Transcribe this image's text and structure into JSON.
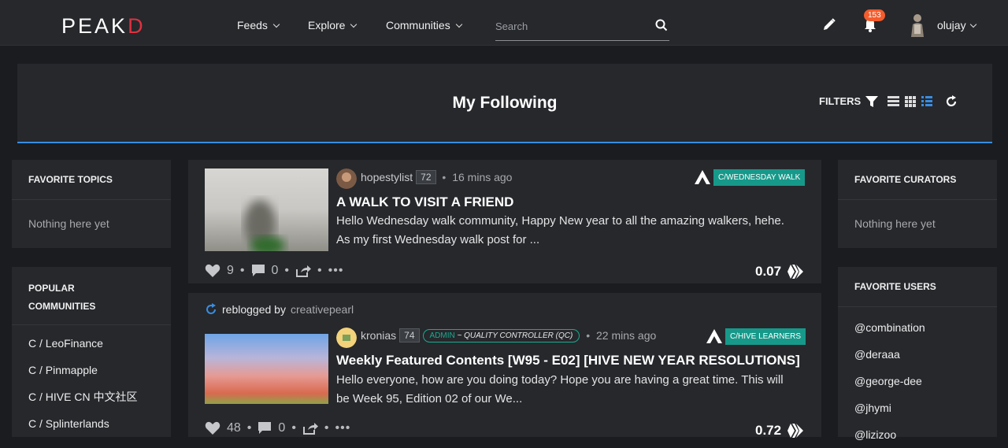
{
  "nav": {
    "logo_left": "PE",
    "logo_mid": "A",
    "logo_k": "K",
    "logo_right": "D",
    "feeds": "Feeds",
    "explore": "Explore",
    "communities": "Communities",
    "search_placeholder": "Search",
    "notification_count": "153",
    "username": "olujay"
  },
  "header": {
    "title": "My Following",
    "filters_label": "FILTERS"
  },
  "left_sidebar": {
    "favorite_topics": {
      "title": "FAVORITE TOPICS",
      "empty": "Nothing here yet"
    },
    "popular_communities": {
      "title_line1": "POPULAR",
      "title_line2": "COMMUNITIES",
      "items": [
        "C / LeoFinance",
        "C / Pinmapple",
        "C / HIVE CN 中文社区",
        "C / Splinterlands"
      ]
    }
  },
  "right_sidebar": {
    "favorite_curators": {
      "title": "FAVORITE CURATORS",
      "empty": "Nothing here yet"
    },
    "favorite_users": {
      "title": "FAVORITE USERS",
      "items": [
        "@combination",
        "@deraaa",
        "@george-dee",
        "@jhymi",
        "@lizizoo"
      ]
    }
  },
  "posts": [
    {
      "author": "hopestylist",
      "reputation": "72",
      "time": "16 mins ago",
      "community": "C/WEDNESDAY WALK",
      "title": "A WALK TO VISIT A FRIEND",
      "body_line1": "Hello Wednesday walk community, Happy New year to all the amazing walkers, hehe.",
      "body_line2": "As my first Wednesday walk post for ...",
      "votes": "9",
      "comments": "0",
      "payout": "0.07"
    },
    {
      "reblog_prefix": "reblogged by",
      "reblogged_by": "creativepearl",
      "author": "kronias",
      "reputation": "74",
      "role_admin": "ADMIN",
      "role_title": "~ QUALITY CONTROLLER (QC)",
      "time": "22 mins ago",
      "community": "C/HIVE LEARNERS",
      "title": "Weekly Featured Contents [W95 - E02] [HIVE NEW YEAR RESOLUTIONS]",
      "body_line1": "Hello everyone, how are you doing today? Hope you are having a great time. This will",
      "body_line2": "be Week 95, Edition 02 of our We...",
      "votes": "48",
      "comments": "0",
      "payout": "0.72"
    }
  ],
  "colors": {
    "accent_blue": "#3a8de0",
    "community_tag": "#17998a",
    "notification_badge": "#f45c2c",
    "logo_red": "#e0313f"
  },
  "icons": [
    "search-icon",
    "pencil-icon",
    "bell-icon",
    "filter-icon",
    "list-view-icon",
    "grid-view-icon",
    "compact-view-icon",
    "refresh-icon",
    "heart-icon",
    "comment-icon",
    "share-icon",
    "more-icon",
    "hive-icon",
    "reblog-icon"
  ]
}
